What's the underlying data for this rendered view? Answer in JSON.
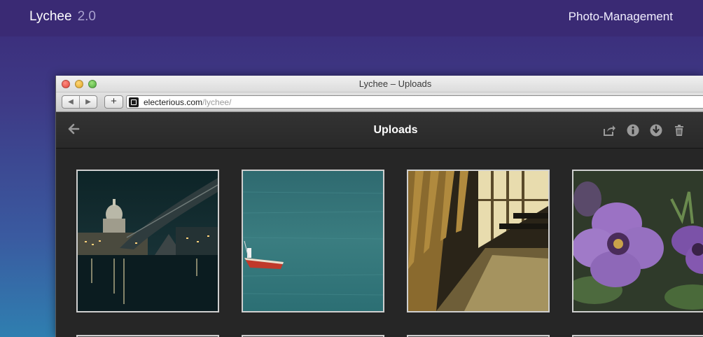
{
  "site": {
    "brand": "Lychee",
    "version": "2.0",
    "tagline": "Photo-Management"
  },
  "browser": {
    "window_title": "Lychee – Uploads",
    "url_domain": "electerious.com",
    "url_path": "/lychee/",
    "back_glyph": "◀",
    "forward_glyph": "▶",
    "new_tab_glyph": "+"
  },
  "app": {
    "album_title": "Uploads",
    "icons": [
      "back-arrow-icon",
      "share-icon",
      "info-icon",
      "download-icon",
      "trash-icon"
    ],
    "icon_color": "#9a9a9a"
  },
  "photos": [
    {
      "subject": "night-city-bridge"
    },
    {
      "subject": "red-boat-teal-water"
    },
    {
      "subject": "wooden-benches-sunlight"
    },
    {
      "subject": "purple-petunia-flower"
    }
  ],
  "colors": {
    "header_bg": "#3a2a74",
    "app_bg": "#262626",
    "photo_border": "#cfcfcf"
  }
}
